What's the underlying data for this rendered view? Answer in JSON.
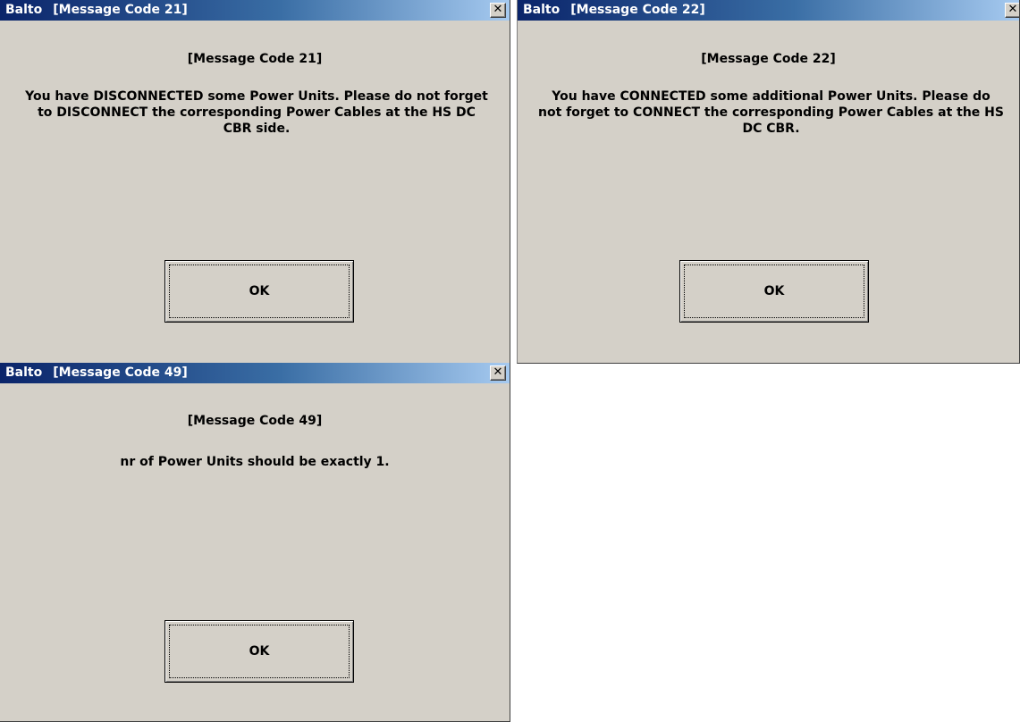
{
  "dialogs": [
    {
      "app_name": "Balto",
      "title": "[Message Code 21]",
      "close_glyph": "✕",
      "heading": "[Message Code 21]",
      "lines": [
        "You have DISCONNECTED some Power Units. Please do not forget",
        "to DISCONNECT the corresponding Power Cables at the HS DC",
        "CBR side."
      ],
      "ok_label": "OK"
    },
    {
      "app_name": "Balto",
      "title": "[Message Code 22]",
      "close_glyph": "✕",
      "heading": "[Message Code 22]",
      "lines": [
        "You have CONNECTED some additional Power Units. Please do",
        "not forget to CONNECT the corresponding Power Cables at the HS",
        "DC CBR."
      ],
      "ok_label": "OK"
    },
    {
      "app_name": "Balto",
      "title": "[Message Code 49]",
      "close_glyph": "✕",
      "heading": "[Message Code 49]",
      "lines": [
        "nr of Power Units should be exactly 1."
      ],
      "ok_label": "OK"
    }
  ],
  "colors": {
    "dialog_background": "#d4d0c8",
    "titlebar_start": "#0a246a",
    "titlebar_end": "#a6caf0"
  },
  "icons": {
    "close": "close-icon"
  }
}
